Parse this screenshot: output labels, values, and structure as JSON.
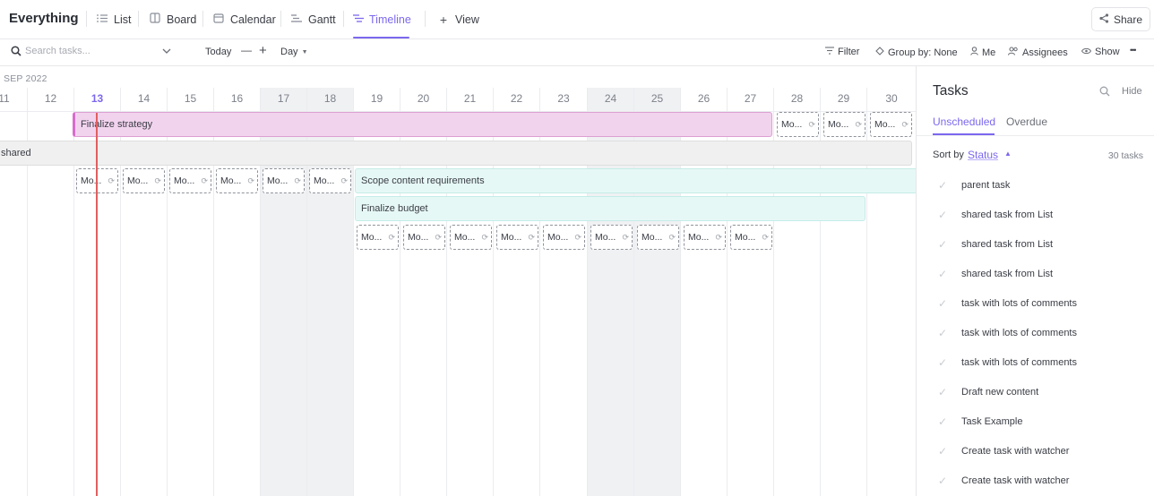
{
  "app": {
    "title": "Everything"
  },
  "views": [
    {
      "label": "List",
      "icon": "list-icon",
      "active": false
    },
    {
      "label": "Board",
      "icon": "board-icon",
      "active": false
    },
    {
      "label": "Calendar",
      "icon": "calendar-icon",
      "active": false
    },
    {
      "label": "Gantt",
      "icon": "gantt-icon",
      "active": false
    },
    {
      "label": "Timeline",
      "icon": "timeline-icon",
      "active": true
    }
  ],
  "add_view": {
    "label": "View"
  },
  "share": {
    "label": "Share"
  },
  "toolbar": {
    "search_placeholder": "Search tasks...",
    "today_label": "Today",
    "minus_symbol": "—",
    "plus_symbol": "+",
    "scale_label": "Day",
    "filter_label": "Filter",
    "group_label": "Group by: None",
    "me_label": "Me",
    "assignees_label": "Assignees",
    "show_label": "Show",
    "more_symbol": "•••"
  },
  "timeline": {
    "month_label": "SEP 2022",
    "days": [
      {
        "num": "11",
        "weekend": false
      },
      {
        "num": "12",
        "weekend": false
      },
      {
        "num": "13",
        "weekend": false,
        "today": true
      },
      {
        "num": "14",
        "weekend": false
      },
      {
        "num": "15",
        "weekend": false
      },
      {
        "num": "16",
        "weekend": false
      },
      {
        "num": "17",
        "weekend": true
      },
      {
        "num": "18",
        "weekend": true
      },
      {
        "num": "19",
        "weekend": false
      },
      {
        "num": "20",
        "weekend": false
      },
      {
        "num": "21",
        "weekend": false
      },
      {
        "num": "22",
        "weekend": false
      },
      {
        "num": "23",
        "weekend": false
      },
      {
        "num": "24",
        "weekend": true
      },
      {
        "num": "25",
        "weekend": true
      },
      {
        "num": "26",
        "weekend": false
      },
      {
        "num": "27",
        "weekend": false
      },
      {
        "num": "28",
        "weekend": false
      },
      {
        "num": "29",
        "weekend": false
      },
      {
        "num": "30",
        "weekend": false
      }
    ],
    "bars": {
      "finalize_strategy": "Finalize strategy",
      "shared": "shared",
      "scope_content": "Scope content requirements",
      "finalize_budget": "Finalize budget"
    },
    "recurring_label": "Mo..."
  },
  "panel": {
    "title": "Tasks",
    "hide_label": "Hide",
    "tabs": [
      "Unscheduled",
      "Overdue"
    ],
    "sort_by_label": "Sort by",
    "sort_value": "Status",
    "task_count": "30 tasks",
    "tasks": [
      "parent task",
      "shared task from List",
      "shared task from List",
      "shared task from List",
      "task with lots of comments",
      "task with lots of comments",
      "task with lots of comments",
      "Draft new content",
      "Task Example",
      "Create task with watcher",
      "Create task with watcher"
    ]
  }
}
